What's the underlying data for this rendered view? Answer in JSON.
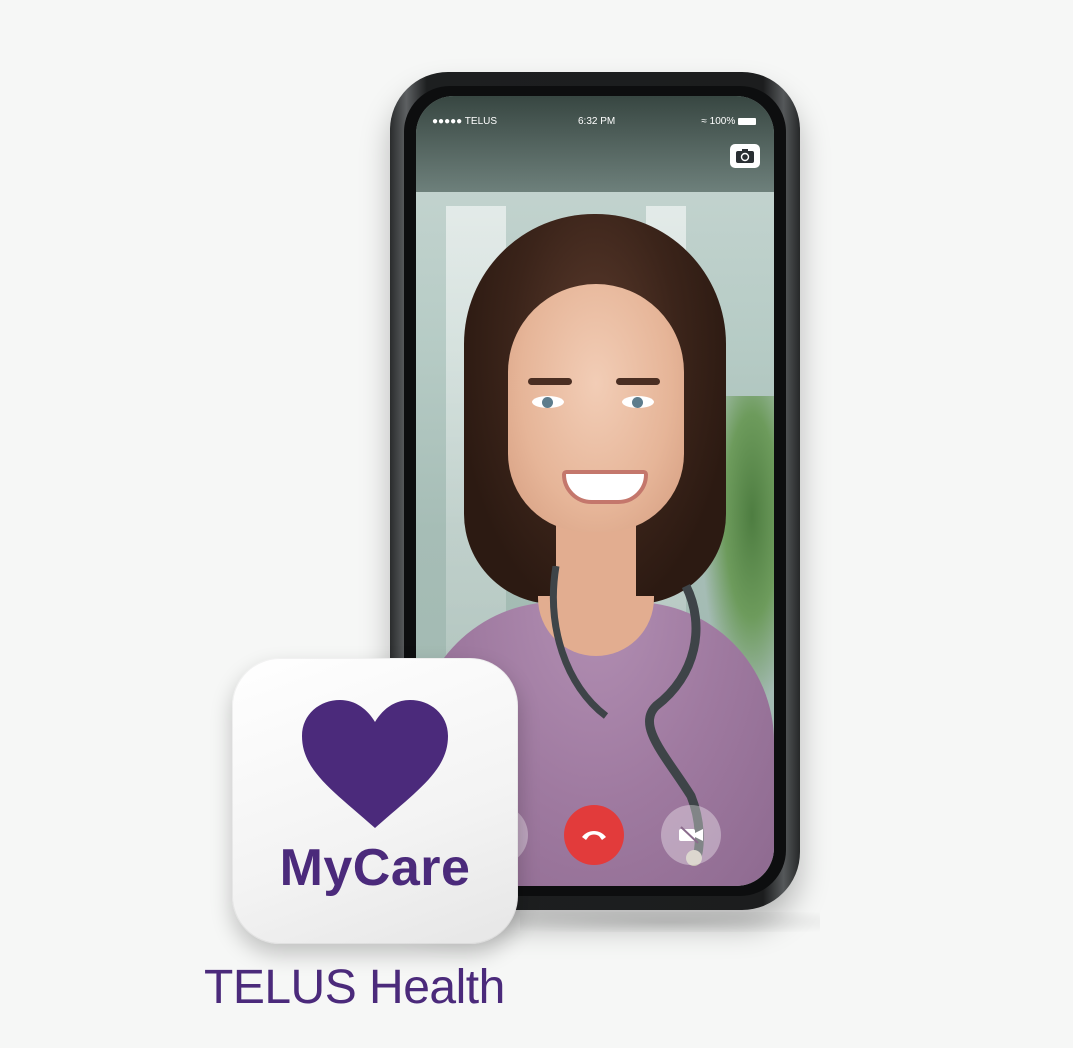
{
  "status_bar": {
    "carrier": "●●●●● TELUS",
    "time": "6:32 PM",
    "battery": "100%"
  },
  "icons": {
    "camera_flip": "camera-flip-icon",
    "end_call": "phone-hangup-icon",
    "video_off": "video-off-icon",
    "wifi": "wifi-icon",
    "battery": "battery-icon"
  },
  "app": {
    "name": "MyCare",
    "brand": "TELUS Health"
  },
  "colors": {
    "brand_purple": "#4b2a7b",
    "end_call_red": "#e23b3b"
  }
}
